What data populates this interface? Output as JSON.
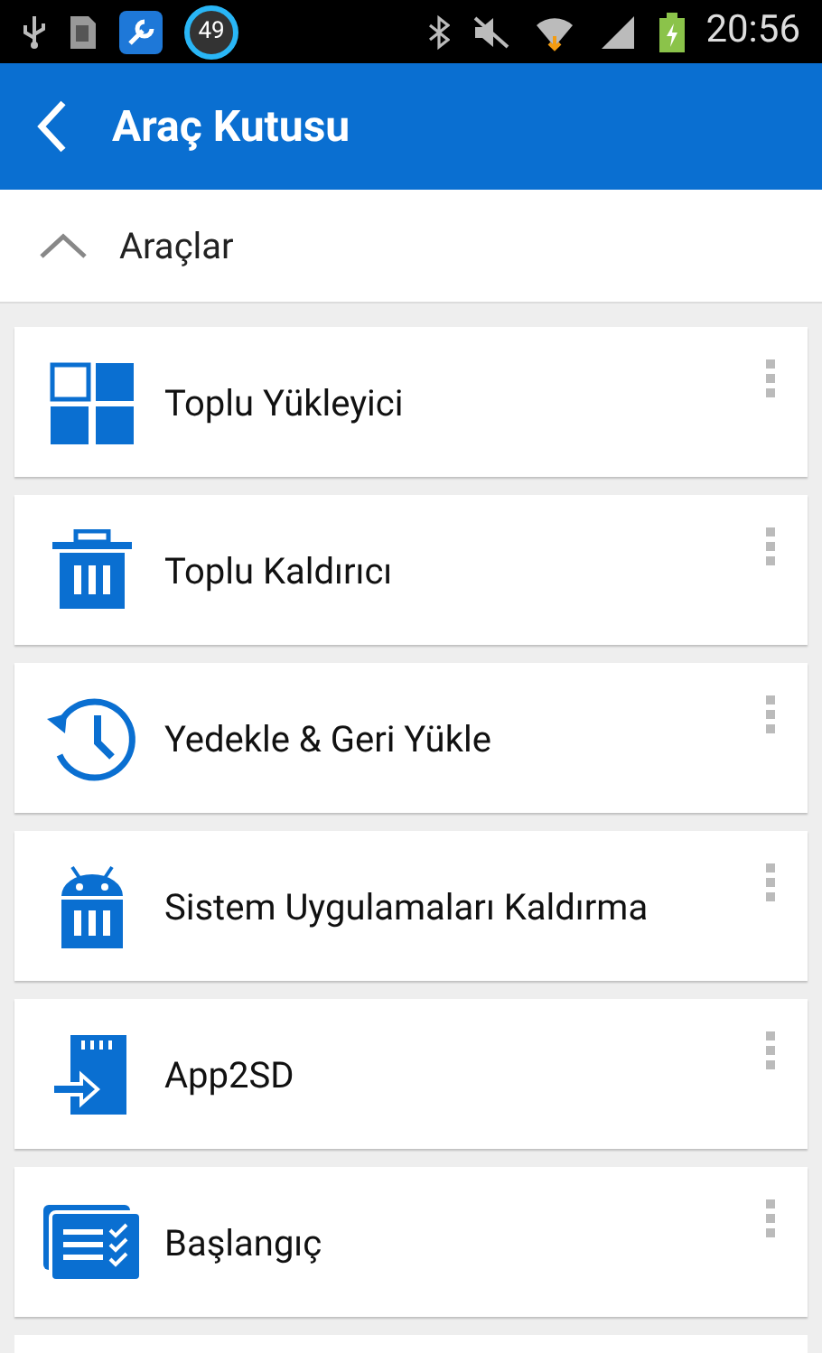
{
  "status_bar": {
    "notification_count": "49",
    "time": "20:56"
  },
  "header": {
    "title": "Araç Kutusu"
  },
  "section": {
    "title": "Araçlar",
    "expanded": true
  },
  "tools": [
    {
      "kind": "grid",
      "label": "Toplu Yükleyici"
    },
    {
      "kind": "trash",
      "label": "Toplu Kaldırıcı"
    },
    {
      "kind": "history",
      "label": "Yedekle & Geri Yükle"
    },
    {
      "kind": "android-trash",
      "label": "Sistem Uygulamaları Kaldırma"
    },
    {
      "kind": "sdcard",
      "label": "App2SD"
    },
    {
      "kind": "checklist",
      "label": "Başlangıç"
    }
  ]
}
